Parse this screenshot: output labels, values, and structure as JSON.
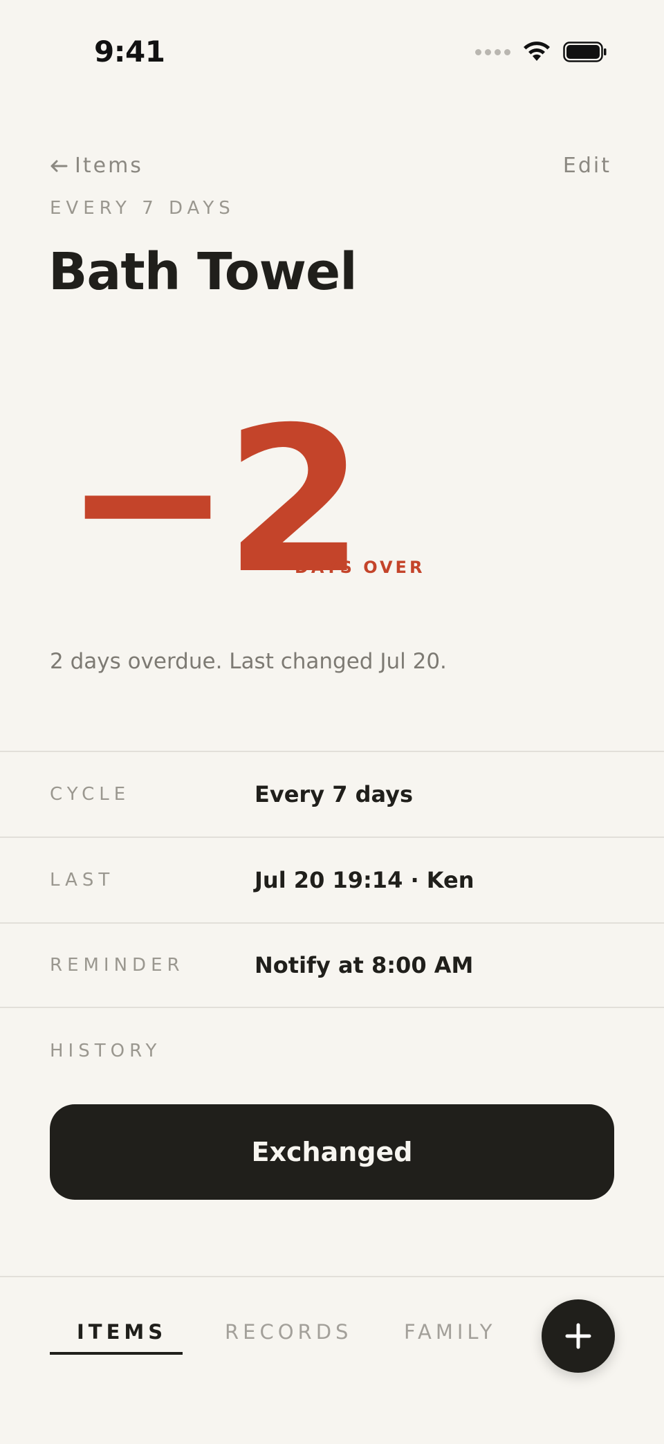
{
  "status_bar": {
    "time": "9:41"
  },
  "header": {
    "back_label": "Items",
    "edit_label": "Edit",
    "cycle_caption": "EVERY 7 DAYS",
    "title": "Bath Towel"
  },
  "counter": {
    "value": "−2",
    "unit": "DAYS OVER",
    "color": "#c4442a"
  },
  "status_line": "2 days overdue. Last changed Jul 20.",
  "details": [
    {
      "label": "CYCLE",
      "value": "Every 7 days"
    },
    {
      "label": "LAST",
      "value": "Jul 20 19:14 · Ken"
    },
    {
      "label": "REMINDER",
      "value": "Notify at 8:00 AM"
    }
  ],
  "history_label": "HISTORY",
  "action_button": "Exchanged",
  "tabs": [
    {
      "label": "ITEMS",
      "active": true
    },
    {
      "label": "RECORDS",
      "active": false
    },
    {
      "label": "FAMILY",
      "active": false
    }
  ],
  "fab_icon": "plus-icon"
}
